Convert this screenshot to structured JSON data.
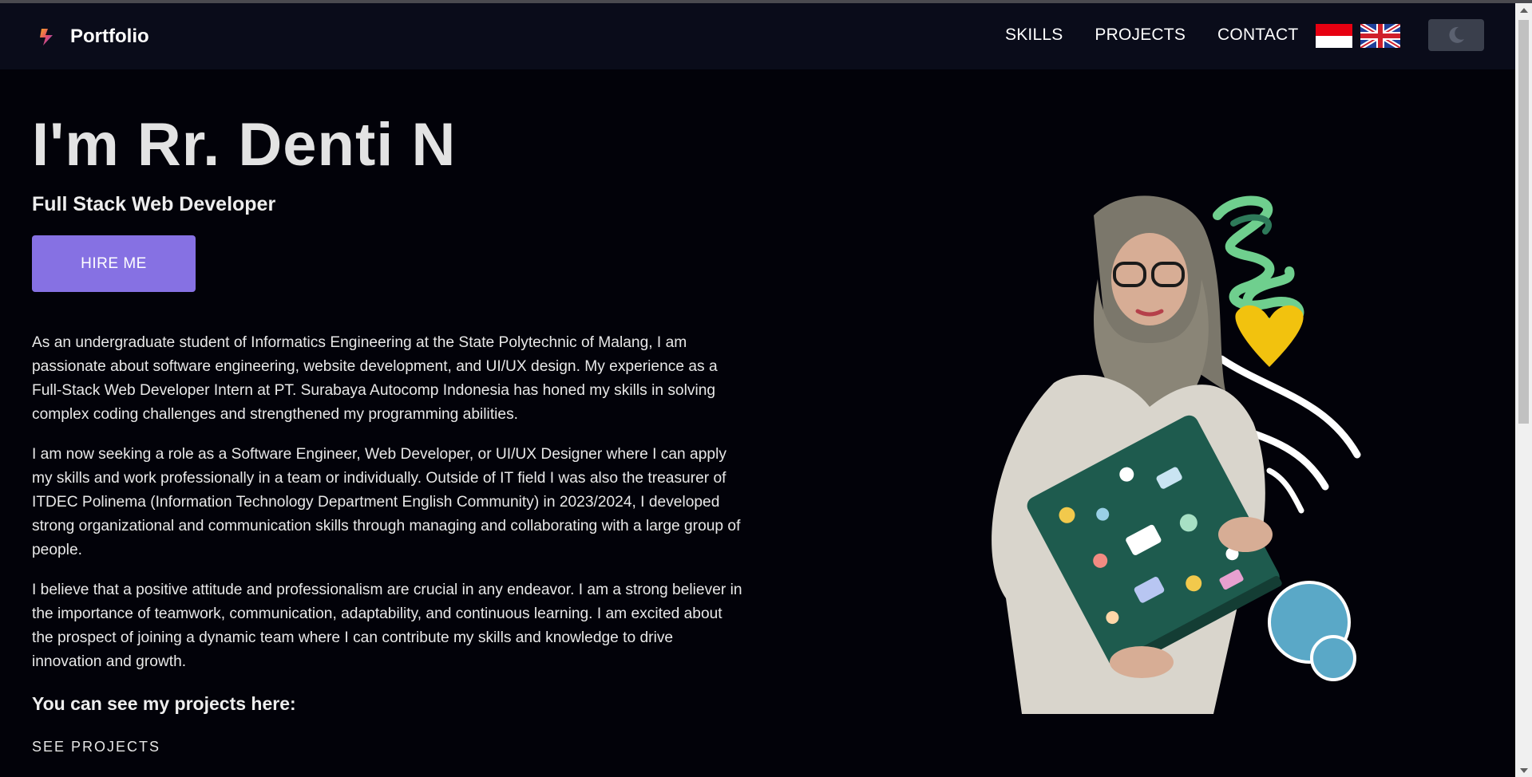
{
  "brand": {
    "name": "Portfolio",
    "logo_icon": "lightning-logo-icon"
  },
  "nav": {
    "items": [
      {
        "label": "SKILLS"
      },
      {
        "label": "PROJECTS"
      },
      {
        "label": "CONTACT"
      }
    ],
    "languages": [
      {
        "icon": "indonesia-flag-icon"
      },
      {
        "icon": "uk-flag-icon"
      }
    ],
    "theme_toggle_icon": "moon-icon"
  },
  "hero": {
    "title": "I'm Rr. Denti N",
    "subtitle": "Full Stack Web Developer",
    "cta_label": "HIRE ME"
  },
  "about": {
    "paragraphs": [
      "As an undergraduate student of Informatics Engineering at the State Polytechnic of Malang, I am passionate about software engineering, website development, and UI/UX design. My experience as a Full-Stack Web Developer Intern at PT. Surabaya Autocomp Indonesia has honed my skills in solving complex coding challenges and strengthened my programming abilities.",
      "I am now seeking a role as a Software Engineer, Web Developer, or UI/UX Designer where I can apply my skills and work professionally in a team or individually. Outside of IT field I was also the treasurer of ITDEC Polinema (Information Technology Department English Community) in 2023/2024, I developed strong organizational and communication skills through managing and collaborating with a large group of people.",
      "I believe that a positive attitude and professionalism are crucial in any endeavor. I am a strong believer in the importance of teamwork, communication, adaptability, and continuous learning. I am excited about the prospect of joining a dynamic team where I can contribute my skills and knowledge to drive innovation and growth."
    ]
  },
  "projects": {
    "heading": "You can see my projects here:",
    "link_label": "SEE PROJECTS"
  },
  "colors": {
    "background": "#020209",
    "navbar": "#0a0c1a",
    "accent": "#8671e3"
  }
}
